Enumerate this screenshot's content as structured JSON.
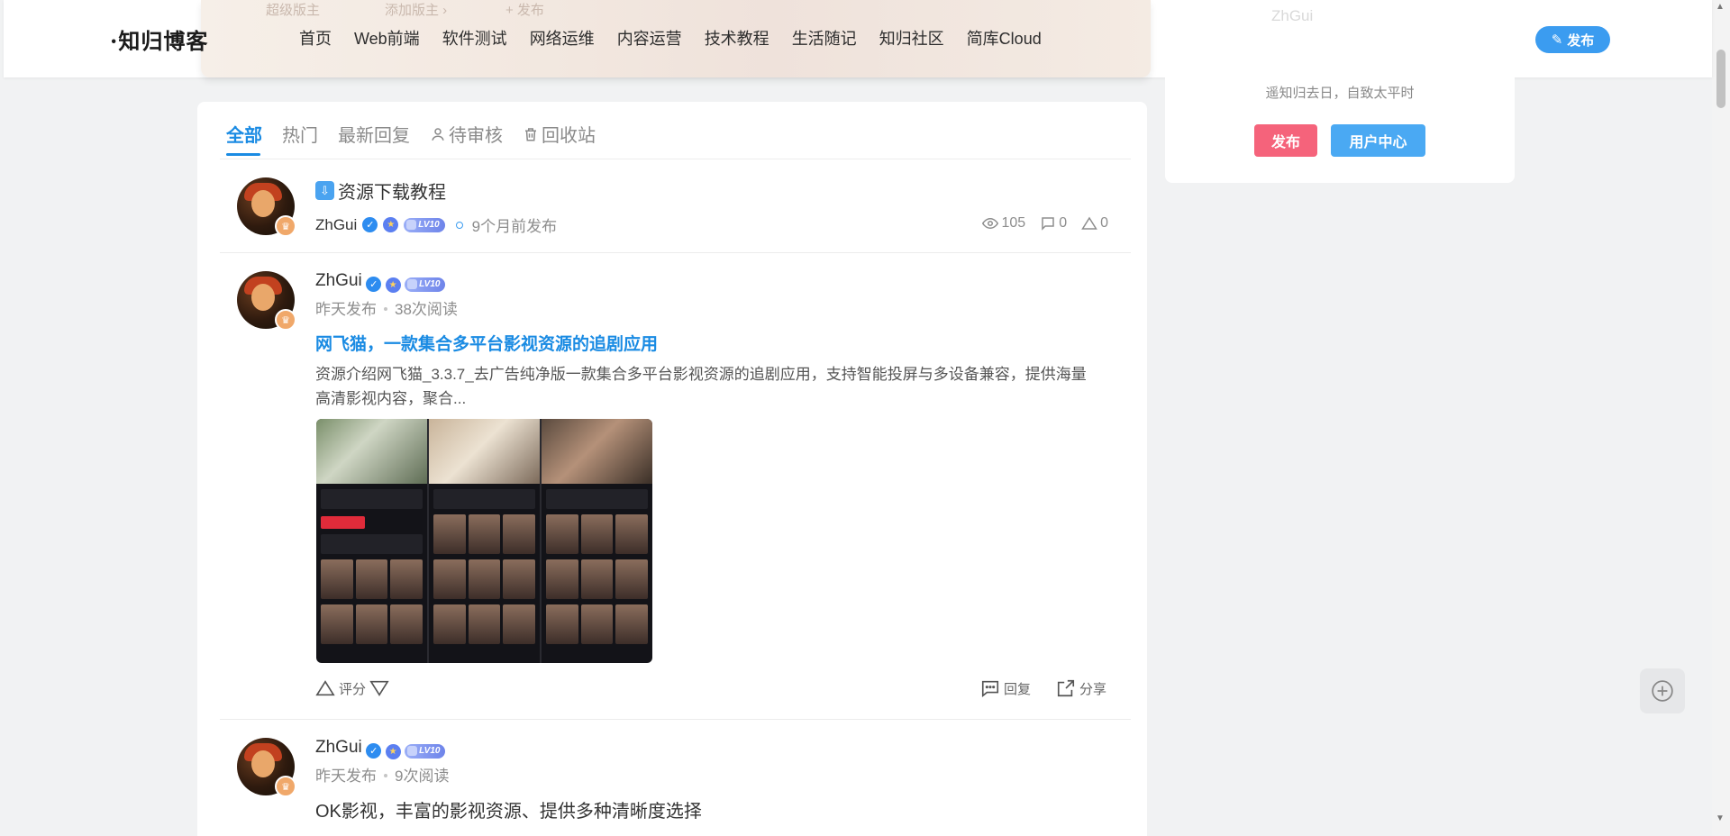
{
  "header": {
    "logo": "·知归博客",
    "nav": [
      "首页",
      "Web前端",
      "软件测试",
      "网络运维",
      "内容运营",
      "技术教程",
      "生活随记",
      "知归社区",
      "简库Cloud"
    ],
    "publish_label": "发布",
    "hero_ghost": [
      "超级版主",
      "添加版主 ›",
      "+ 发布"
    ]
  },
  "sidebar": {
    "ghost_name": "ZhGui",
    "motto": "遥知归去日，自致太平时",
    "btn_publish": "发布",
    "btn_user_center": "用户中心"
  },
  "tabs": [
    {
      "label": "全部",
      "active": true
    },
    {
      "label": "热门"
    },
    {
      "label": "最新回复"
    },
    {
      "label": "待审核",
      "icon": "user-check-icon"
    },
    {
      "label": "回收站",
      "icon": "trash-icon"
    }
  ],
  "post1": {
    "title": "资源下载教程",
    "author": "ZhGui",
    "level": "LV10",
    "time": "9个月前发布",
    "views": "105",
    "comments": "0",
    "likes": "0"
  },
  "post2": {
    "author": "ZhGui",
    "level": "LV10",
    "time": "昨天发布",
    "reads": "38次阅读",
    "title": "网飞猫，一款集合多平台影视资源的追剧应用",
    "excerpt": "资源介绍网飞猫_3.3.7_去广告纯净版一款集合多平台影视资源的追剧应用，支持智能投屏与多设备兼容，提供海量高清影视内容，聚合...",
    "rate_label": "评分",
    "reply_label": "回复",
    "share_label": "分享"
  },
  "post3": {
    "author": "ZhGui",
    "level": "LV10",
    "time": "昨天发布",
    "reads": "9次阅读",
    "title": "OK影视，丰富的影视资源、提供多种清晰度选择"
  }
}
